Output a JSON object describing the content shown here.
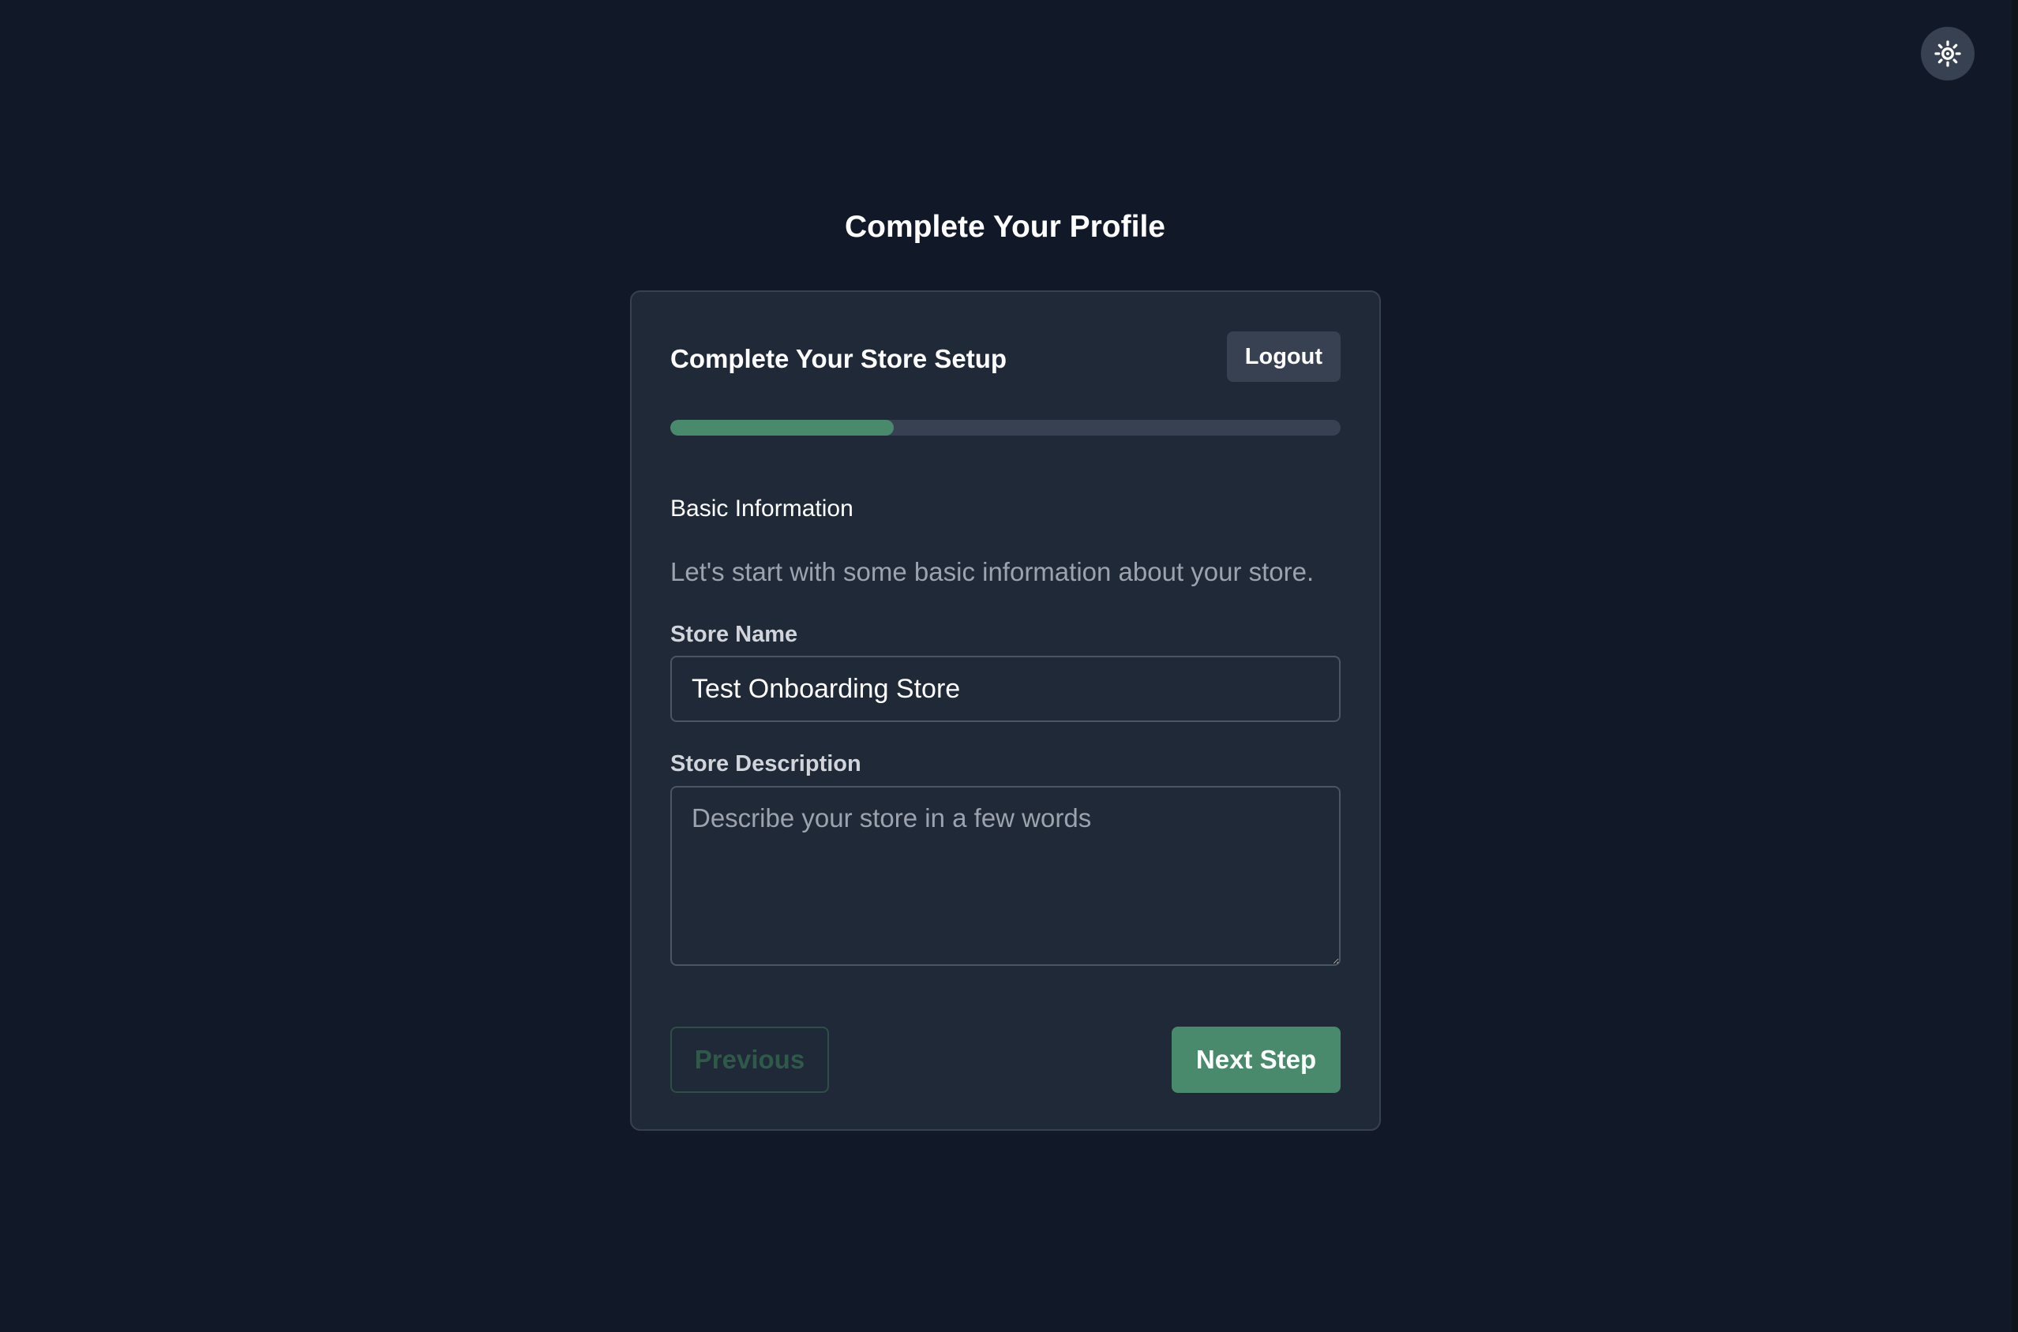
{
  "page": {
    "title": "Complete Your Profile"
  },
  "theme_toggle": {
    "icon": "sun-icon"
  },
  "card": {
    "title": "Complete Your Store Setup",
    "logout_label": "Logout",
    "progress": {
      "current_step": 1,
      "total_steps": 3,
      "fraction": 0.333
    },
    "step": {
      "title": "Basic Information",
      "description": "Let's start with some basic information about your store."
    },
    "fields": {
      "store_name": {
        "label": "Store Name",
        "value": "Test Onboarding Store"
      },
      "store_description": {
        "label": "Store Description",
        "placeholder": "Describe your store in a few words",
        "value": ""
      }
    },
    "buttons": {
      "previous": "Previous",
      "next": "Next Step"
    }
  },
  "colors": {
    "background": "#111827",
    "card": "#1f2937",
    "accent": "#4a8a6c",
    "muted_text": "#9ca3af"
  }
}
